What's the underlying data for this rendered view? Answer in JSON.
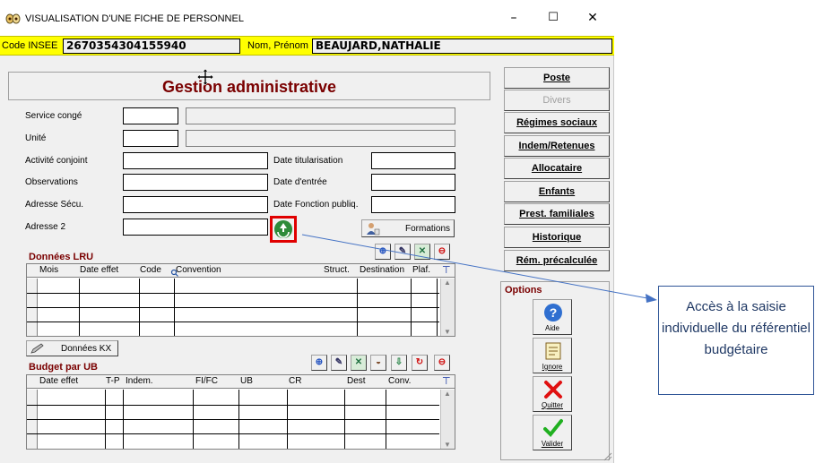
{
  "window": {
    "title": "VISUALISATION D'UNE FICHE DE PERSONNEL",
    "minimize": "–",
    "maximize": "☐",
    "close": "✕"
  },
  "infobar": {
    "insee_label": "Code INSEE",
    "insee_value": "2670354304155940",
    "name_label": "Nom, Prénom",
    "name_value": "BEAUJARD,NATHALIE"
  },
  "page_title": "Gestion administrative",
  "form": {
    "service_conge": "Service congé",
    "unite": "Unité",
    "activite_conjoint": "Activité conjoint",
    "observations": "Observations",
    "adresse_secu": "Adresse Sécu.",
    "adresse2": "Adresse 2",
    "date_titularisation": "Date titularisation",
    "date_entree": "Date d'entrée",
    "date_fonction": "Date Fonction publiq.",
    "formations_btn": "Formations"
  },
  "lru": {
    "title": "Données LRU",
    "columns": [
      "Mois",
      "Date effet",
      "Code",
      "Convention",
      "Struct.",
      "Destination",
      "Plaf."
    ]
  },
  "kx_button": "Données KX",
  "budget": {
    "title": "Budget par UB",
    "columns": [
      "Date effet",
      "T-P",
      "Indem.",
      "FI/FC",
      "UB",
      "CR",
      "Dest",
      "Conv."
    ]
  },
  "side_buttons": {
    "poste": "Poste",
    "divers": "Divers",
    "regimes": "Régimes sociaux",
    "indem": "Indem/Retenues",
    "allocataire": "Allocataire",
    "enfants": "Enfants",
    "prest": "Prest. familiales",
    "historique": "Historique",
    "rem": "Rém. précalculée"
  },
  "options": {
    "title": "Options",
    "aide": "Aide",
    "ignore": "Ignore",
    "quitter": "Quitter",
    "valider": "Valider"
  },
  "callout": {
    "text": "Accès à la saisie individuelle du référentiel budgétaire"
  },
  "colors": {
    "title_red": "#7a0000",
    "info_yellow": "#ffff00",
    "highlight_red": "#e00000",
    "callout_blue": "#2f5597"
  }
}
